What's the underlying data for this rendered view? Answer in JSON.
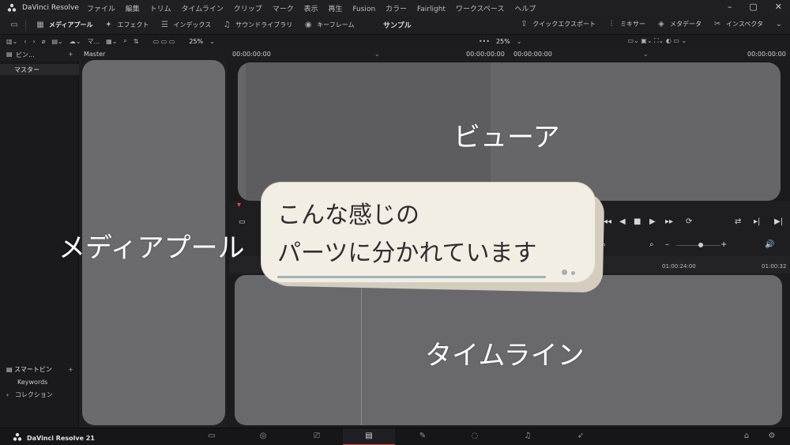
{
  "window": {
    "app_name": "DaVinci Resolve",
    "menu": [
      "ファイル",
      "編集",
      "トリム",
      "タイムライン",
      "クリップ",
      "マーク",
      "表示",
      "再生",
      "Fusion",
      "カラー",
      "Fairlight",
      "ワークスペース",
      "ヘルプ"
    ]
  },
  "toolbar": {
    "media_pool": "メディアプール",
    "effects": "エフェクト",
    "index": "インデックス",
    "sound_library": "サウンドライブラリ",
    "keyframe": "キーフレーム",
    "project_title": "サンプル",
    "quick_export": "クイックエクスポート",
    "mixer": "ミキサー",
    "metadata": "メタデータ",
    "inspector": "インスペクタ"
  },
  "subbar": {
    "bin_mode": "マ...",
    "zoom_left": "25%",
    "zoom_right": "25%"
  },
  "header": {
    "bins_label": "ビン...",
    "master_label": "Master",
    "source_timecode": "00:00:00:00",
    "source_timecode_right": "00:00:00:00",
    "program_timecode": "00:00:00:00",
    "program_timecode_right": "00:00:00:00"
  },
  "bins": {
    "master": "マスター",
    "smart_bins": "スマートビン",
    "keywords": "Keywords",
    "collections": "コレクション"
  },
  "ruler": {
    "tick1": "01:00:24:00",
    "tick2": "01:00:32"
  },
  "bottom": {
    "brand": "DaVinci Resolve 21"
  },
  "overlay": {
    "media_pool": "メディアプール",
    "viewer": "ビューア",
    "timeline": "タイムライン",
    "note_line1": "こんな感じの",
    "note_line2": "パーツに分かれています"
  },
  "colors": {
    "accent_red": "#e04848",
    "panel_gray": "#6a6a6f",
    "note_bg": "#f3eee4"
  }
}
